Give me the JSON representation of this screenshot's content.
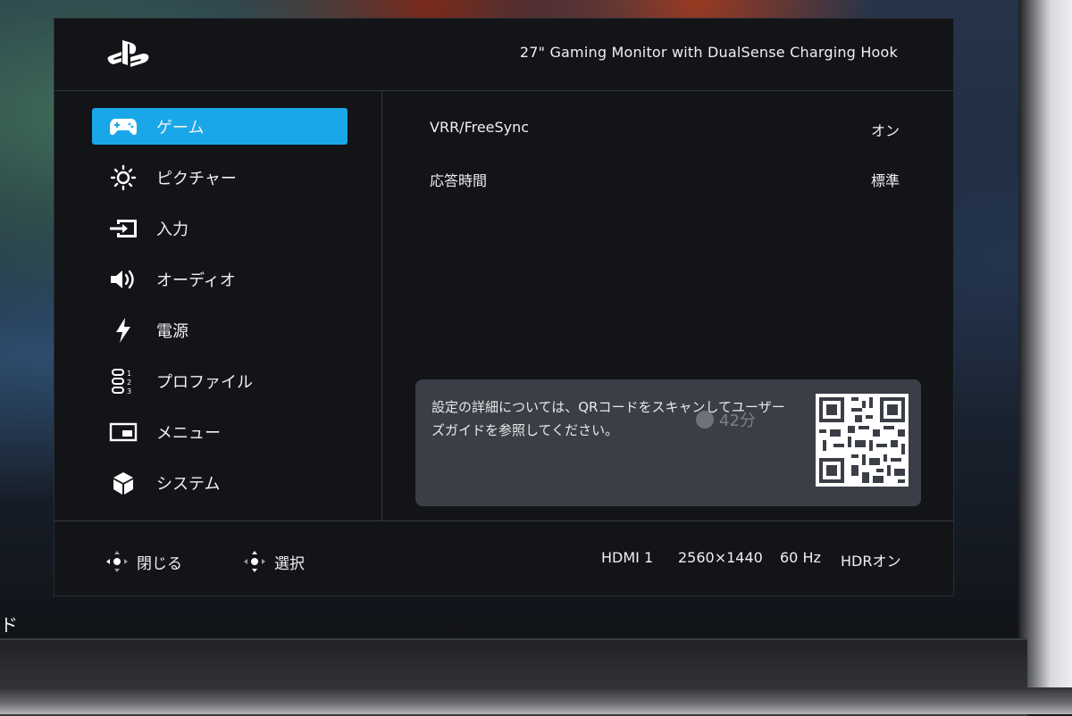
{
  "header": {
    "logo_icon": "playstation-logo-icon",
    "model_title": "27\" Gaming Monitor with DualSense Charging Hook"
  },
  "sidebar": {
    "items": [
      {
        "label": "ゲーム",
        "icon": "gamepad-icon",
        "active": true
      },
      {
        "label": "ピクチャー",
        "icon": "brightness-icon",
        "active": false
      },
      {
        "label": "入力",
        "icon": "input-icon",
        "active": false
      },
      {
        "label": "オーディオ",
        "icon": "speaker-icon",
        "active": false
      },
      {
        "label": "電源",
        "icon": "lightning-icon",
        "active": false
      },
      {
        "label": "プロファイル",
        "icon": "profile-icon",
        "active": false
      },
      {
        "label": "メニュー",
        "icon": "menu-window-icon",
        "active": false
      },
      {
        "label": "システム",
        "icon": "cube-icon",
        "active": false
      }
    ]
  },
  "settings": [
    {
      "name": "VRR/FreeSync",
      "value": "オン"
    },
    {
      "name": "応答時間",
      "value": "標準"
    }
  ],
  "info": {
    "text": "設定の詳細については、QRコードをスキャンしてユーザーズガイドを参照してください。",
    "qr_icon": "qr-code-icon",
    "overlay_timer": "42分"
  },
  "footer": {
    "close_label": "閉じる",
    "select_label": "選択",
    "input": "HDMI 1",
    "resolution": "2560×1440",
    "refresh": "60 Hz",
    "hdr": "HDRオン"
  },
  "outside_text": "ド",
  "colors": {
    "accent": "#1aa7ea",
    "panel_bg": "#121418",
    "info_bg": "#3b3e46"
  }
}
